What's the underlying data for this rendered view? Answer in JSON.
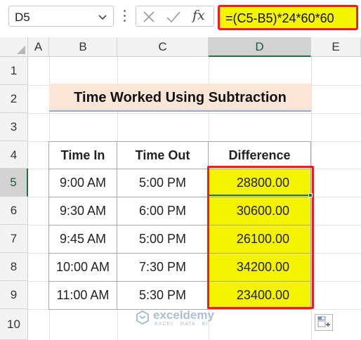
{
  "formula_bar": {
    "name_box": "D5",
    "cancel_icon": "close-icon",
    "enter_icon": "check-icon",
    "function_label": "fx",
    "formula": "=(C5-B5)*24*60*60"
  },
  "columns": [
    "A",
    "B",
    "C",
    "D",
    "E"
  ],
  "rows": [
    "1",
    "2",
    "3",
    "4",
    "5",
    "6",
    "7",
    "8",
    "9",
    "10"
  ],
  "selected_cell": "D5",
  "sheet": {
    "title": "Time Worked Using Subtraction",
    "headers": {
      "time_in": "Time In",
      "time_out": "Time Out",
      "difference": "Difference"
    },
    "data": [
      {
        "time_in": "9:00 AM",
        "time_out": "5:00 PM",
        "difference": "28800.00"
      },
      {
        "time_in": "9:30 AM",
        "time_out": "6:00 PM",
        "difference": "30600.00"
      },
      {
        "time_in": "9:45 AM",
        "time_out": "5:00 PM",
        "difference": "26100.00"
      },
      {
        "time_in": "10:00 AM",
        "time_out": "7:30 PM",
        "difference": "34200.00"
      },
      {
        "time_in": "11:00 AM",
        "time_out": "5:30 PM",
        "difference": "23400.00"
      }
    ]
  },
  "watermark": {
    "name": "exceldemy",
    "tagline": "EXCEL · DATA · BI"
  },
  "colors": {
    "highlight": "#f4f400",
    "outline": "#ee1c25",
    "title_fill": "#fbe5d6",
    "selection": "#1e7145"
  }
}
